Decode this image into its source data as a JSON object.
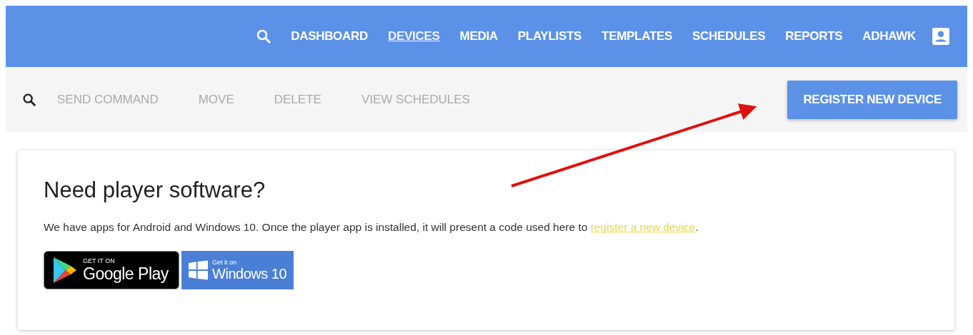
{
  "top_nav": {
    "items": [
      {
        "label": "DASHBOARD",
        "selected": false
      },
      {
        "label": "DEVICES",
        "selected": true
      },
      {
        "label": "MEDIA",
        "selected": false
      },
      {
        "label": "PLAYLISTS",
        "selected": false
      },
      {
        "label": "TEMPLATES",
        "selected": false
      },
      {
        "label": "SCHEDULES",
        "selected": false
      },
      {
        "label": "REPORTS",
        "selected": false
      },
      {
        "label": "ADHAWK",
        "selected": false
      }
    ]
  },
  "toolbar": {
    "actions": [
      {
        "label": "SEND COMMAND",
        "disabled": true
      },
      {
        "label": "MOVE",
        "disabled": true
      },
      {
        "label": "DELETE",
        "disabled": true
      },
      {
        "label": "VIEW SCHEDULES",
        "disabled": true
      }
    ],
    "primary_button": "REGISTER NEW DEVICE"
  },
  "card": {
    "title": "Need player software?",
    "text_before": "We have apps for Android and Windows 10. Once the player app is installed, it will present a code used here to ",
    "link": "register a new device",
    "text_after": ".",
    "badges": [
      {
        "kind": "google",
        "small": "GET IT ON",
        "big": "Google Play"
      },
      {
        "kind": "windows",
        "small": "Get it on",
        "big": "Windows 10"
      }
    ]
  }
}
